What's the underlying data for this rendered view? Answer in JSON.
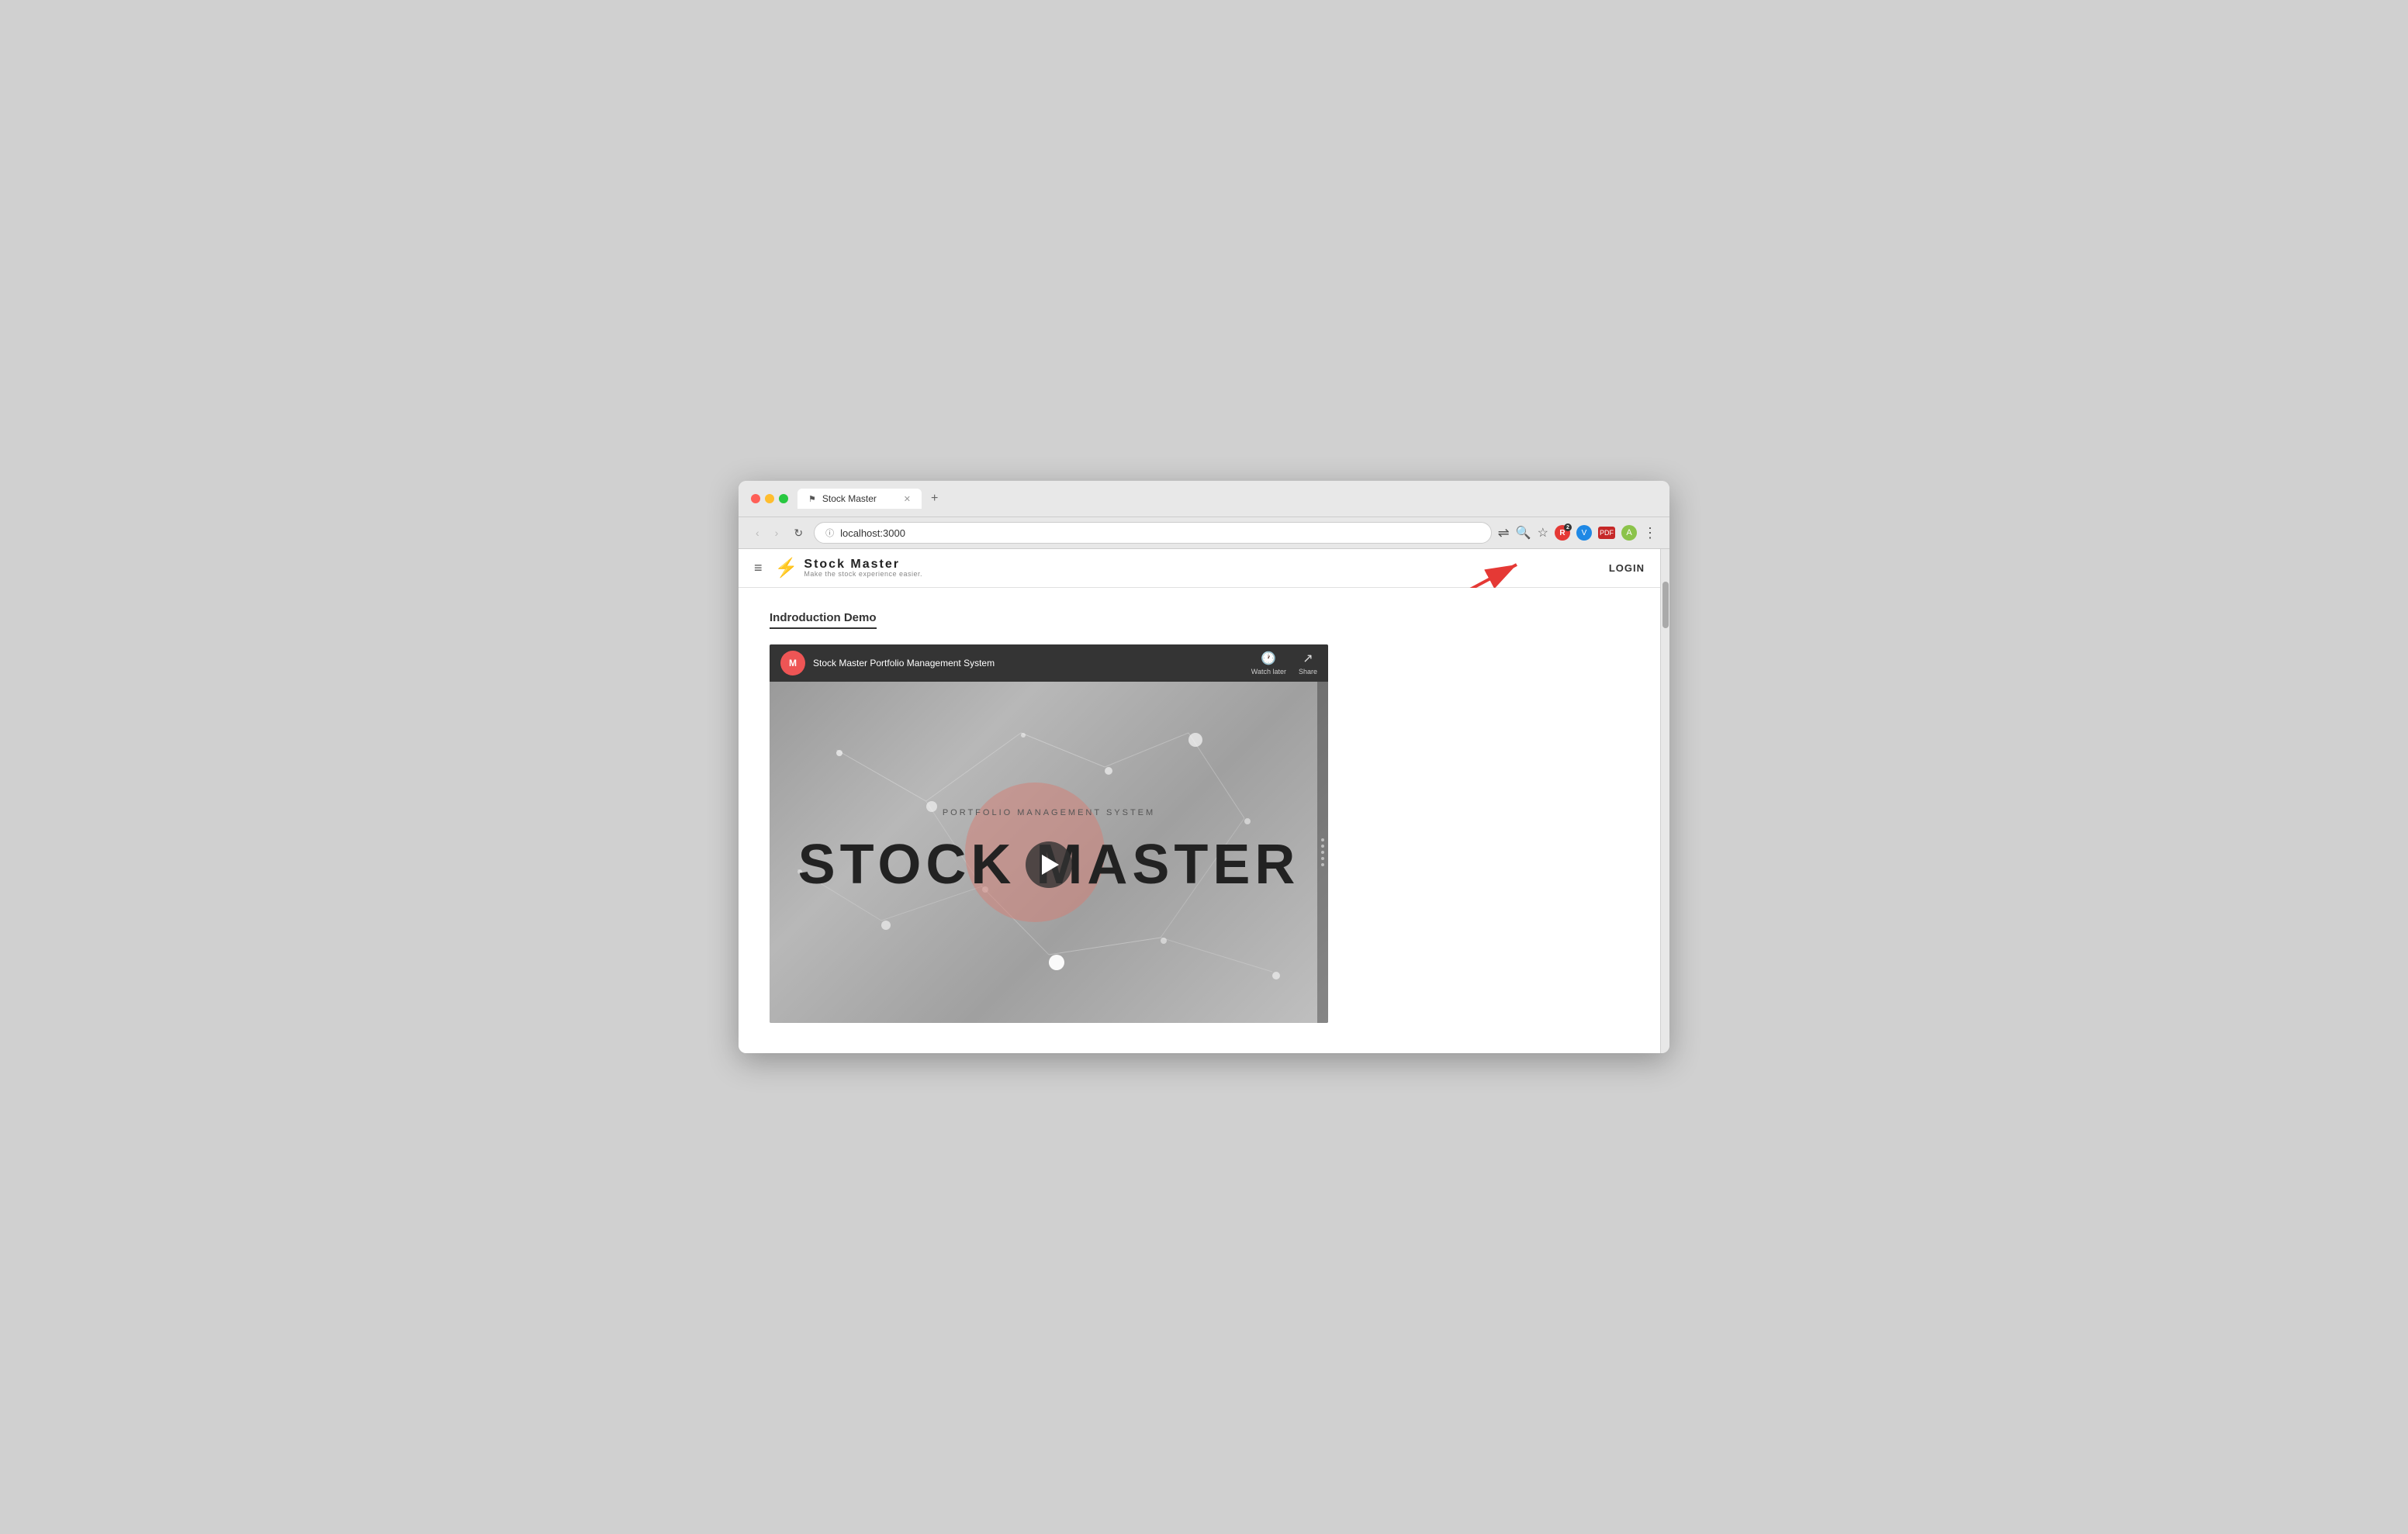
{
  "browser": {
    "tab_title": "Stock Master",
    "tab_icon": "⚑",
    "url": "localhost:3000",
    "new_tab_label": "+",
    "nav": {
      "back_label": "‹",
      "forward_label": "›",
      "reload_label": "↻"
    },
    "extensions": {
      "translate_label": "A",
      "badge_label": "2",
      "menu_label": "⋮"
    }
  },
  "app": {
    "header": {
      "hamburger_label": "≡",
      "logo_title": "Stock  Master",
      "logo_subtitle": "Make the stock experience easier.",
      "login_label": "LOGIN"
    }
  },
  "page": {
    "section_title": "Indroduction Demo",
    "video": {
      "channel_name": "Stock Master Portfolio Management System",
      "watch_later_label": "Watch later",
      "share_label": "Share",
      "portfolio_label": "PORTFOLIO MANAGEMENT SYSTEM",
      "main_title": "STOCK MASTER",
      "play_button_label": "Play"
    }
  }
}
